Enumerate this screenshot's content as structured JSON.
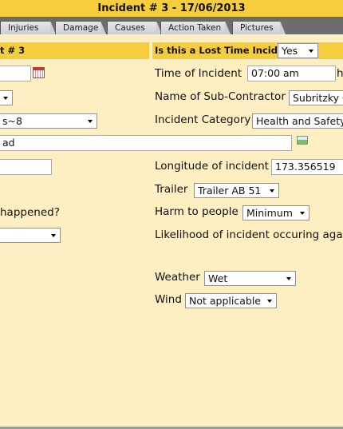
{
  "window": {
    "title": "Incident # 3 - 17/06/2013"
  },
  "tabs": [
    {
      "label": "Injuries"
    },
    {
      "label": "Damage"
    },
    {
      "label": "Causes"
    },
    {
      "label": "Action Taken"
    },
    {
      "label": "Pictures"
    }
  ],
  "left_section": {
    "title": "t # 3"
  },
  "right_section": {
    "lost_time_label": "Is this a Lost Time Incident",
    "lost_time_value": "Yes"
  },
  "left_fields": {
    "date_value": "",
    "select_1_value": "",
    "select_2_value": "s~8",
    "address_value": "ad",
    "text_field_value": "",
    "question_label": "happened?",
    "select_3_value": ""
  },
  "right_fields": {
    "time_label": "Time of Incident",
    "time_value": "07:00 am",
    "time_suffix": "h",
    "subcontractor_label": "Name of Sub-Contractor",
    "subcontractor_value": "Subritzky C",
    "category_label": "Incident Category",
    "category_value": "Health and Safety",
    "longitude_label": "Longitude of incident",
    "longitude_value": "173.356519",
    "trailer_label": "Trailer",
    "trailer_value": "Trailer AB 51",
    "harm_label": "Harm to people",
    "harm_value": "Minimum",
    "likelihood_label": "Likelihood of incident occuring aga",
    "weather_label": "Weather",
    "weather_value": "Wet",
    "wind_label": "Wind",
    "wind_value": "Not applicable"
  },
  "icons": {
    "calendar": "calendar-icon",
    "map": "map-icon",
    "dropdown": "chevron-down-icon"
  },
  "colors": {
    "background": "#fdefc2",
    "header": "#f6cd3c",
    "tab_bar": "#6d6d6d"
  }
}
